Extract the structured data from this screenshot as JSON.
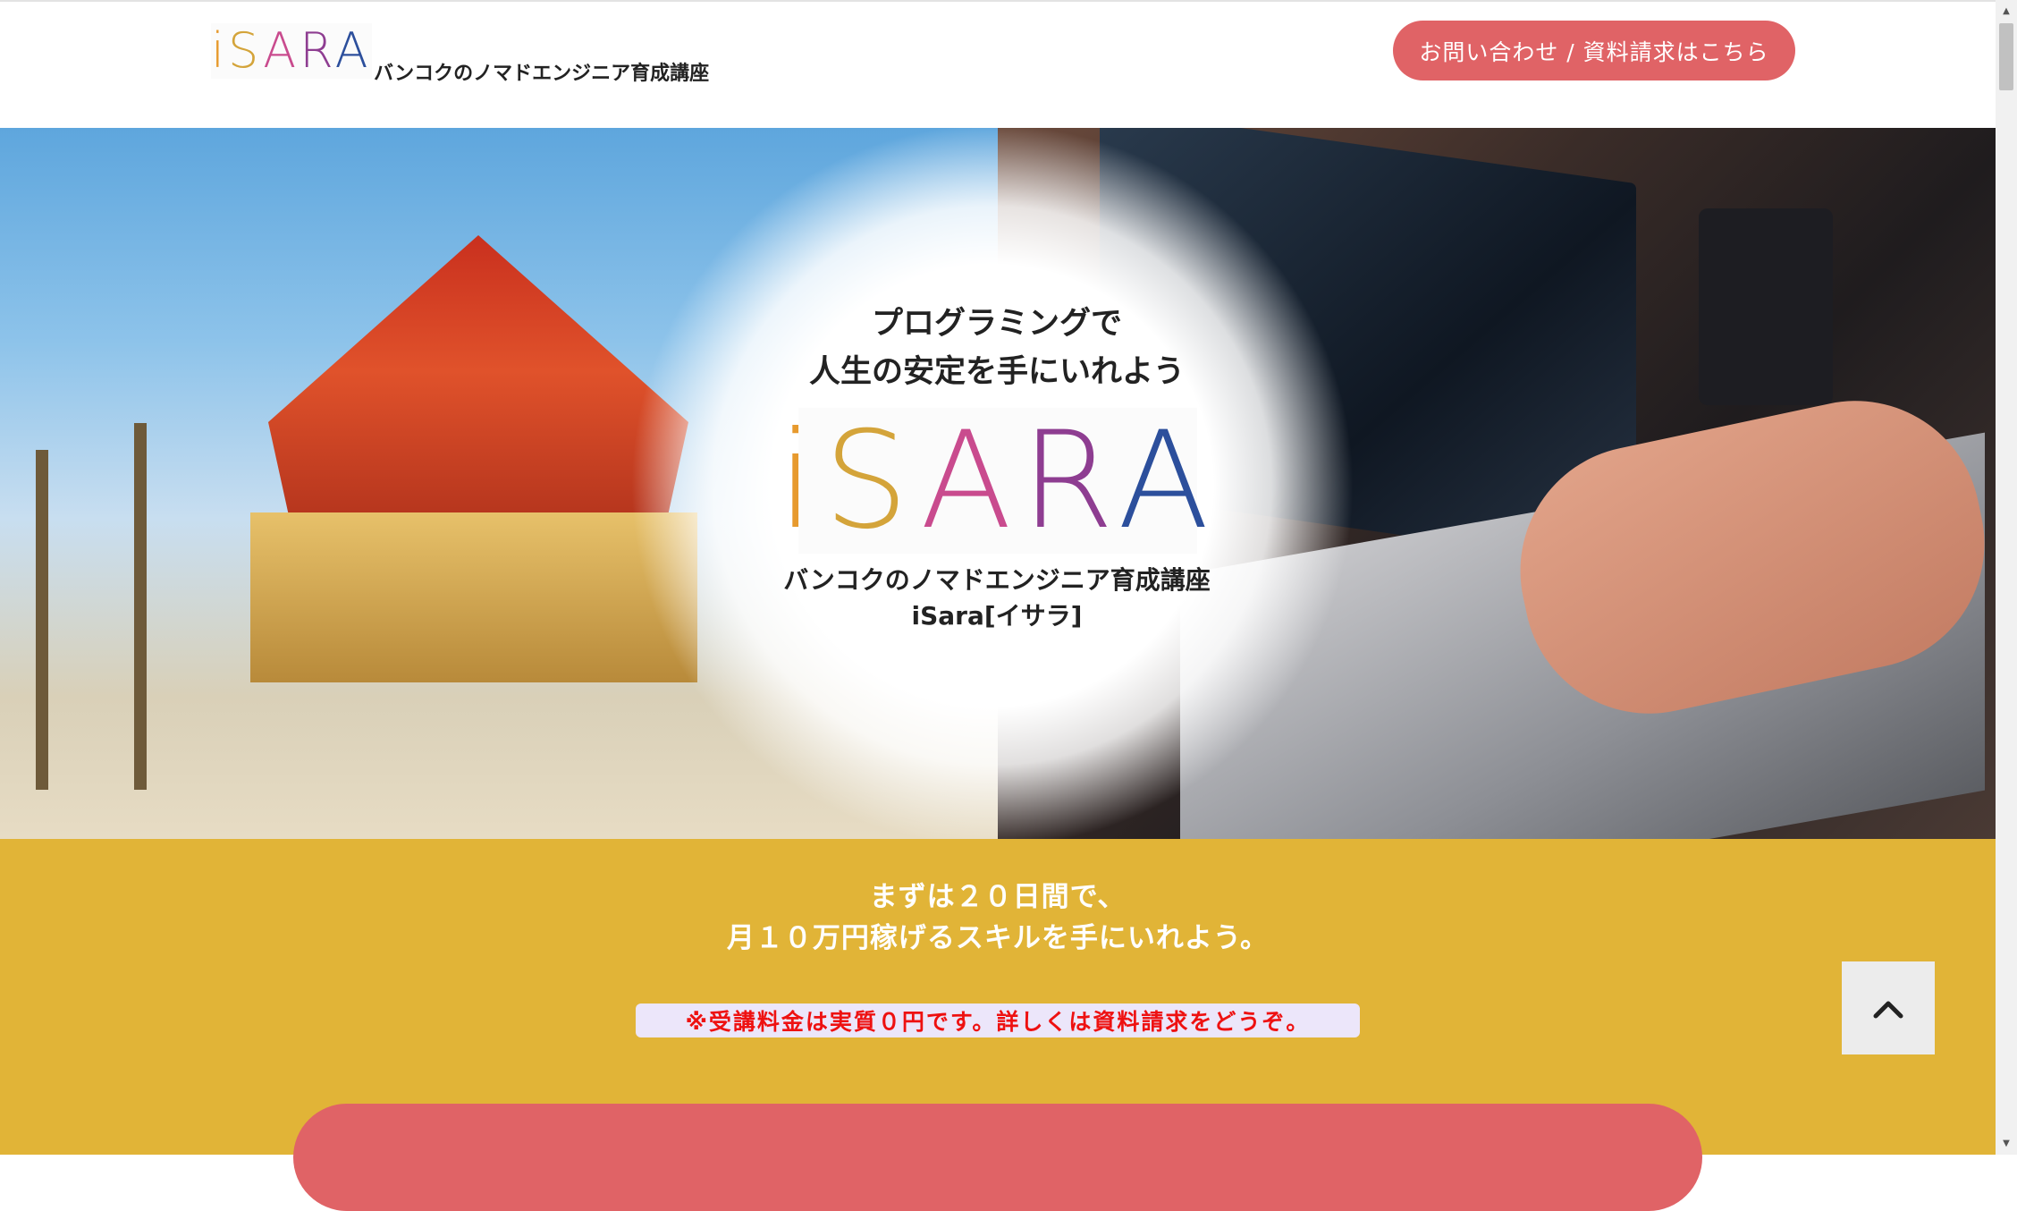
{
  "header": {
    "logo_letters": [
      "i",
      "S",
      "A",
      "R",
      "A"
    ],
    "logo_colors": [
      "#e79a2e",
      "#d4a43a",
      "#c94b8e",
      "#8e3d91",
      "#2c4f9c"
    ],
    "tagline": "バンコクのノマドエンジニア育成講座",
    "cta_label": "お問い合わせ / 資料請求はこちら"
  },
  "hero": {
    "headline_line1": "プログラミングで",
    "headline_line2": "人生の安定を手にいれよう",
    "logo_letters": [
      "i",
      "S",
      "A",
      "R",
      "A"
    ],
    "sub_line1": "バンコクのノマドエンジニア育成講座",
    "sub_line2": "iSara[イサラ]"
  },
  "promo": {
    "line1": "まずは２０日間で、",
    "line2": "月１０万円稼げるスキルを手にいれよう。",
    "note": "※受講料金は実質０円です。詳しくは資料請求をどうぞ。"
  },
  "back_to_top": {
    "icon": "chevron-up-icon"
  },
  "colors": {
    "accent": "#e06366",
    "promo_bg": "#e1b437",
    "note_text": "#ee1111"
  }
}
